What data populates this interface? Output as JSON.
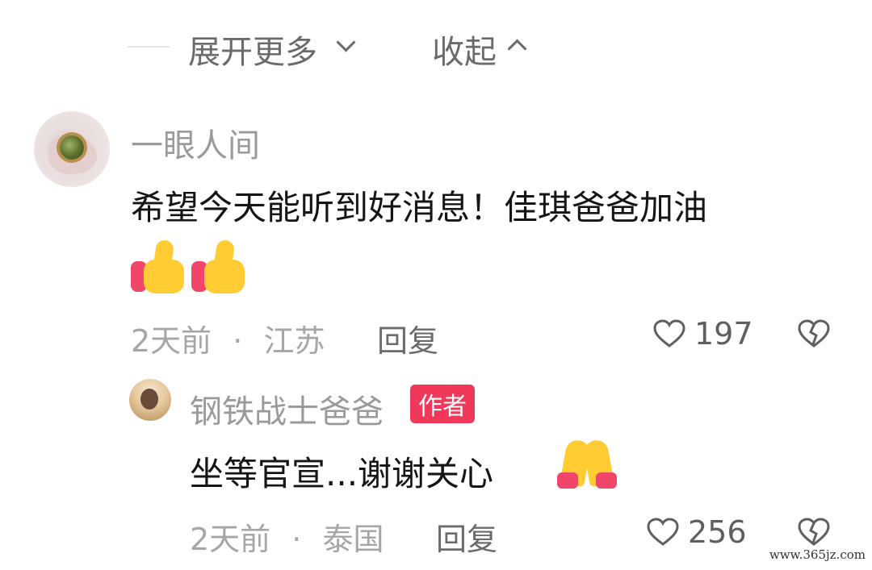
{
  "thread_controls": {
    "expand_more": "展开更多",
    "collapse": "收起"
  },
  "comments": [
    {
      "username": "一眼人间",
      "text": "希望今天能听到好消息！佳琪爸爸加油",
      "emoji": [
        "thumbs-up",
        "thumbs-up"
      ],
      "time": "2天前",
      "separator": "·",
      "location": "江苏",
      "reply_label": "回复",
      "likes": "197"
    },
    {
      "username": "钢铁战士爸爸",
      "badge": "作者",
      "text": "坐等官宣...谢谢关心",
      "emoji": [
        "folded-hands"
      ],
      "time": "2天前",
      "separator": "·",
      "location": "泰国",
      "reply_label": "回复",
      "likes": "256"
    }
  ],
  "watermark": "www.365jz.com",
  "colors": {
    "badge": "#f0395a",
    "text_primary": "#151515",
    "text_secondary": "#9a9a9a"
  }
}
